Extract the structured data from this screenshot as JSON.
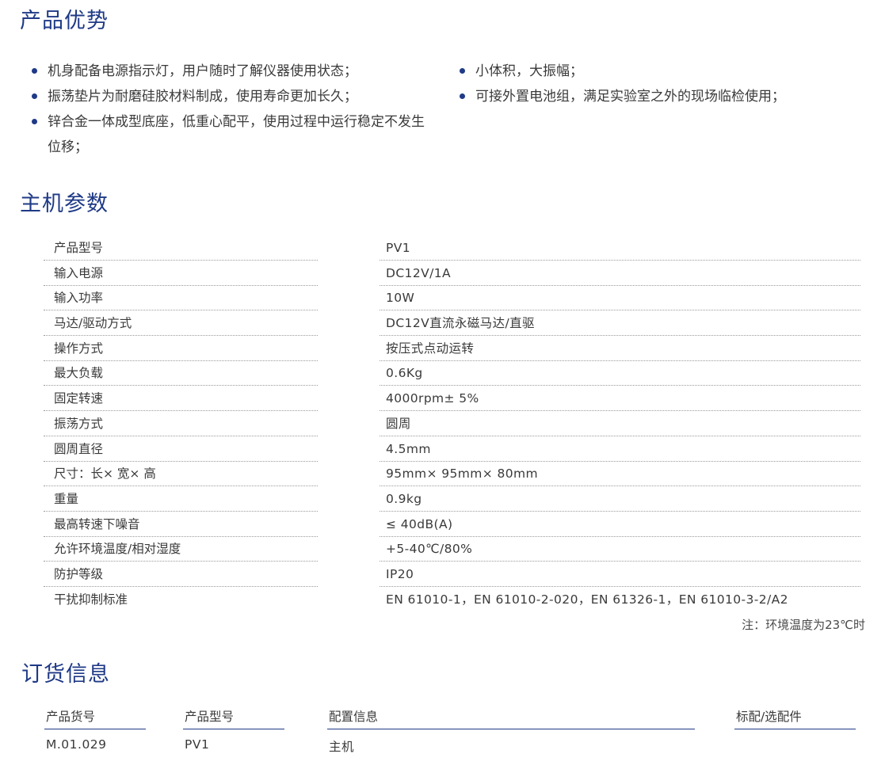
{
  "advantages": {
    "title": "产品优势",
    "left_items": [
      "机身配备电源指示灯，用户随时了解仪器使用状态；",
      "振荡垫片为耐磨硅胶材料制成，使用寿命更加长久；",
      "锌合金一体成型底座，低重心配平，使用过程中运行稳定不发生位移；"
    ],
    "right_items": [
      "小体积，大振幅；",
      "可接外置电池组，满足实验室之外的现场临检使用；"
    ]
  },
  "params": {
    "title": "主机参数",
    "rows": [
      {
        "name": "产品型号",
        "value": "PV1"
      },
      {
        "name": "输入电源",
        "value": "DC12V/1A"
      },
      {
        "name": "输入功率",
        "value": "10W"
      },
      {
        "name": "马达/驱动方式",
        "value": "DC12V直流永磁马达/直驱"
      },
      {
        "name": "操作方式",
        "value": "按压式点动运转"
      },
      {
        "name": "最大负载",
        "value": "0.6Kg"
      },
      {
        "name": "固定转速",
        "value": "4000rpm± 5%"
      },
      {
        "name": "振荡方式",
        "value": "圆周"
      },
      {
        "name": "圆周直径",
        "value": "4.5mm"
      },
      {
        "name": "尺寸：长× 宽× 高",
        "value": "95mm× 95mm× 80mm"
      },
      {
        "name": "重量",
        "value": "0.9kg"
      },
      {
        "name": "最高转速下噪音",
        "value": "≤ 40dB(A)"
      },
      {
        "name": "允许环境温度/相对湿度",
        "value": "+5-40℃/80%"
      },
      {
        "name": "防护等级",
        "value": "IP20"
      },
      {
        "name": "干扰抑制标准",
        "value": "EN 61010-1，EN 61010-2-020，EN 61326-1，EN 61010-3-2/A2"
      }
    ],
    "note": "注：环境温度为23℃时"
  },
  "order": {
    "title": "订货信息",
    "headers": [
      "产品货号",
      "产品型号",
      "配置信息",
      "标配/选配件"
    ],
    "rows": [
      [
        "M.01.029",
        "PV1",
        "主机",
        ""
      ]
    ]
  },
  "colors": {
    "accent": "#1f3a86",
    "text": "#3a3a3a"
  }
}
